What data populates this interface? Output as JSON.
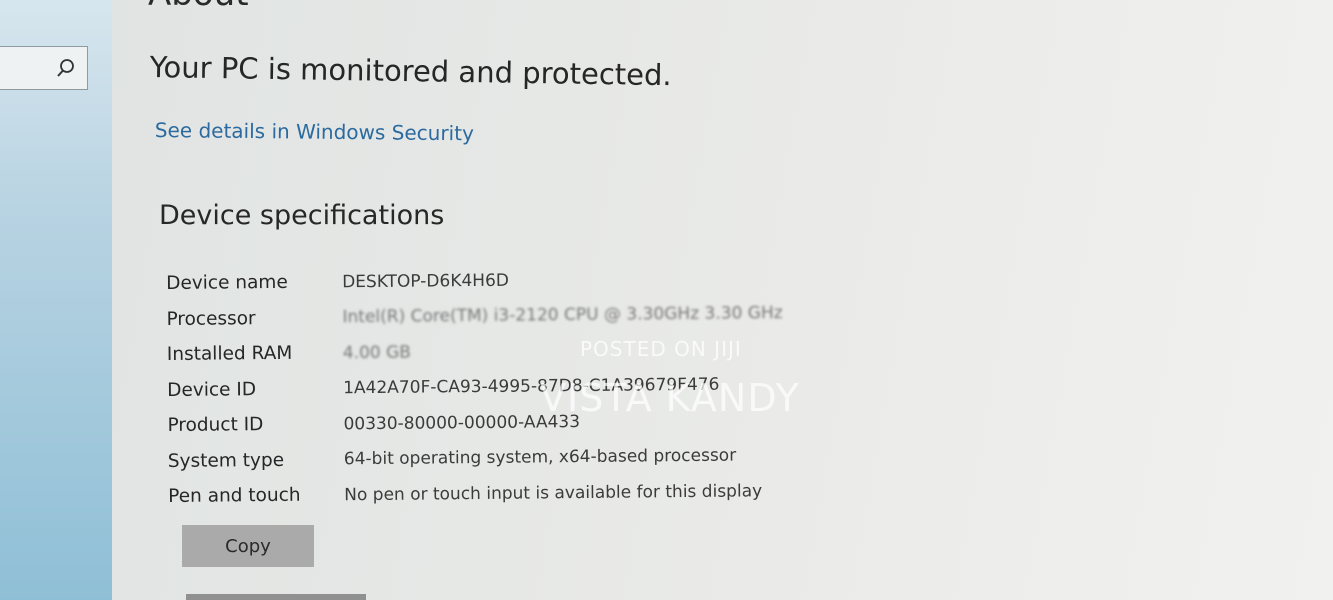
{
  "page": {
    "title": "About",
    "status": "Your PC is monitored and protected.",
    "security_link": "See details in Windows Security"
  },
  "search": {
    "icon": "search-icon"
  },
  "specs": {
    "heading": "Device specifications",
    "rows": [
      {
        "label": "Device name",
        "value": "DESKTOP-D6K4H6D"
      },
      {
        "label": "Processor",
        "value": "Intel(R) Core(TM) i3-2120 CPU @ 3.30GHz 3.30 GHz"
      },
      {
        "label": "Installed RAM",
        "value": "4.00 GB"
      },
      {
        "label": "Device ID",
        "value": "1A42A70F-CA93-4995-87D8-C1A39679F476"
      },
      {
        "label": "Product ID",
        "value": "00330-80000-00000-AA433"
      },
      {
        "label": "System type",
        "value": "64-bit operating system, x64-based processor"
      },
      {
        "label": "Pen and touch",
        "value": "No pen or touch input is available for this display"
      }
    ]
  },
  "buttons": {
    "copy": "Copy"
  },
  "watermark": {
    "line1": "POSTED ON JIJI",
    "line2": "VISTA KANDY"
  }
}
